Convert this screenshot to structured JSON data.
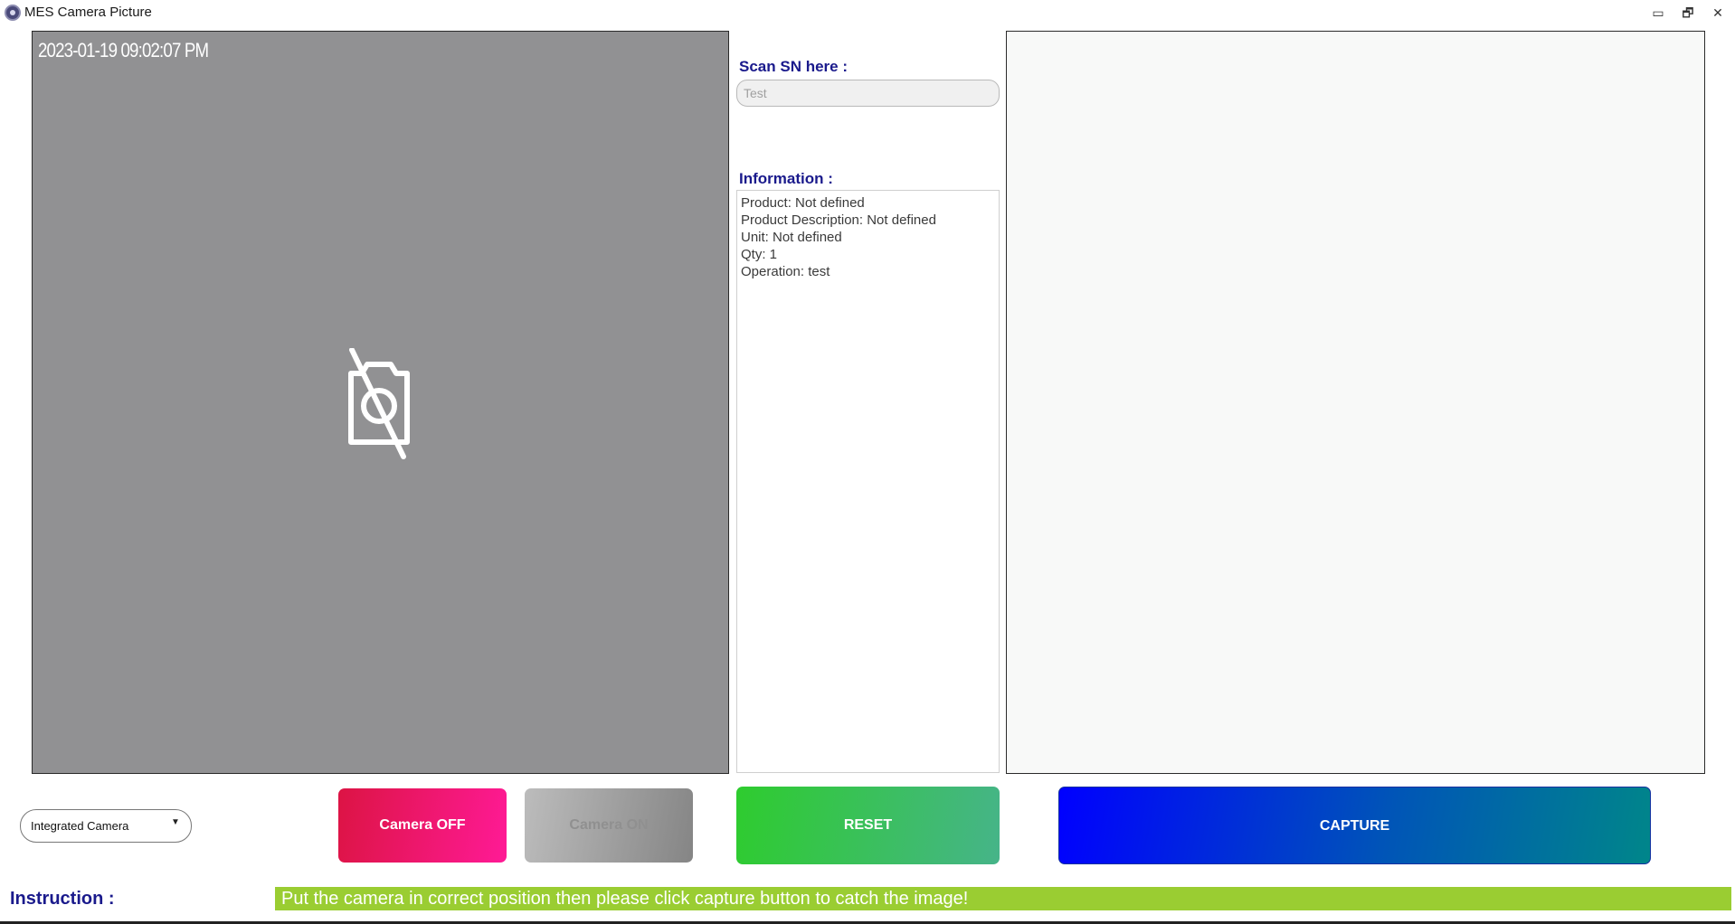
{
  "window": {
    "title": "MES Camera Picture",
    "controls": {
      "minimize": "▭",
      "restore": "🗗",
      "close": "✕"
    }
  },
  "camera": {
    "timestamp": "2023-01-19 09:02:07 PM",
    "status_icon": "camera-off-icon"
  },
  "scan": {
    "label": "Scan SN here :",
    "value": "Test"
  },
  "information": {
    "label": "Information :",
    "lines": [
      "Product: Not defined",
      "Product Description: Not defined",
      "Unit: Not defined",
      "Qty: 1",
      "Operation: test"
    ]
  },
  "controls": {
    "camera_select": "Integrated Camera",
    "camera_off": "Camera OFF",
    "camera_on": "Camera ON",
    "reset": "RESET",
    "capture": "CAPTURE"
  },
  "instruction": {
    "label": "Instruction :",
    "text": "Put the camera in correct position then please click capture button to catch the image!"
  },
  "colors": {
    "label_blue": "#1a1a8c",
    "instruction_bg": "#9acd32",
    "camera_view_bg": "#919193"
  }
}
